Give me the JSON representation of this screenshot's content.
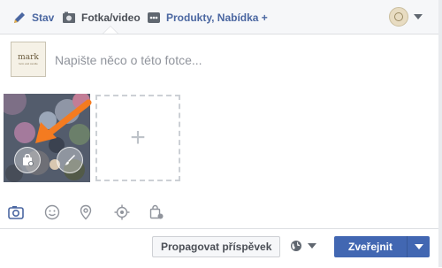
{
  "tabs": {
    "stav": "Stav",
    "foto": "Fotka/video",
    "produkty": "Produkty, Nabídka +"
  },
  "composer": {
    "placeholder": "Napište něco o této fotce...",
    "avatar_brand": "mark",
    "avatar_sub": "farm and candle"
  },
  "add_photo": {
    "symbol": "+"
  },
  "actions": [
    "camera-icon",
    "smiley-icon",
    "location-pin-icon",
    "target-icon",
    "product-bag-icon"
  ],
  "bottom": {
    "boost_label": "Propagovat příspěvek",
    "publish_label": "Zveřejnit"
  },
  "colors": {
    "link_blue": "#4b67a1",
    "primary_button": "#4267b2",
    "arrow_orange": "#f47b20"
  }
}
